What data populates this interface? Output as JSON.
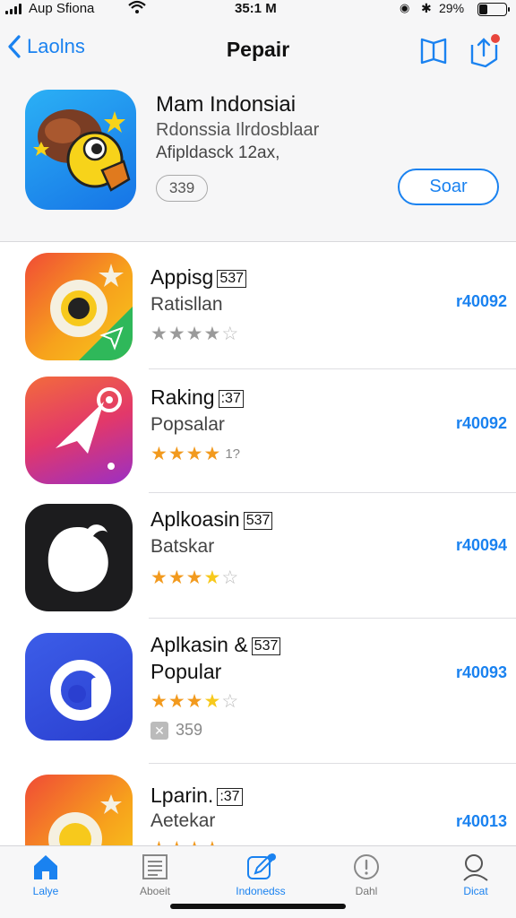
{
  "status": {
    "carrier": "Aup Sfiona",
    "time": "35:1 M",
    "battery": "29%"
  },
  "nav": {
    "back_label": "Laolns",
    "title": "Pepair"
  },
  "featured": {
    "title": "Mam Indonsiai",
    "subtitle": "Rdonssia Ilrdosblaar",
    "meta": "Afipldasck 12ax,",
    "price": "339",
    "get_label": "Soar"
  },
  "apps": [
    {
      "name": "Appisg",
      "tag": "537",
      "category": "Ratisllan",
      "rating": 4,
      "rating_count": "",
      "price": "r40092"
    },
    {
      "name": "Raking",
      "tag": ":37",
      "category": "Popsalar",
      "rating": 4,
      "rating_count": "1?",
      "price": "r40092"
    },
    {
      "name": "Aplkoasin",
      "tag": "537",
      "category": "Batskar",
      "rating": 3.5,
      "rating_count": "",
      "price": "r40094"
    },
    {
      "name": "Aplkasin &",
      "tag": "537",
      "category": "Popular",
      "rating": 4,
      "rating_count": "",
      "price": "r40093",
      "badge": "359"
    },
    {
      "name": "Lparin.",
      "tag": ":37",
      "category": "Aetekar",
      "rating": 4,
      "rating_count": "",
      "price": "r40013"
    }
  ],
  "tabs": [
    {
      "label": "Lalye",
      "icon": "home-icon",
      "active": true
    },
    {
      "label": "Aboeit",
      "icon": "document-icon",
      "active": false
    },
    {
      "label": "Indonedss",
      "icon": "compose-icon",
      "active": false
    },
    {
      "label": "Dahl",
      "icon": "clock-icon",
      "active": false
    },
    {
      "label": "Dicat",
      "icon": "search-icon",
      "active": false
    }
  ],
  "colors": {
    "accent": "#1a82f0",
    "star_orange": "#f29a1e",
    "star_gray": "#9a9a9a"
  }
}
